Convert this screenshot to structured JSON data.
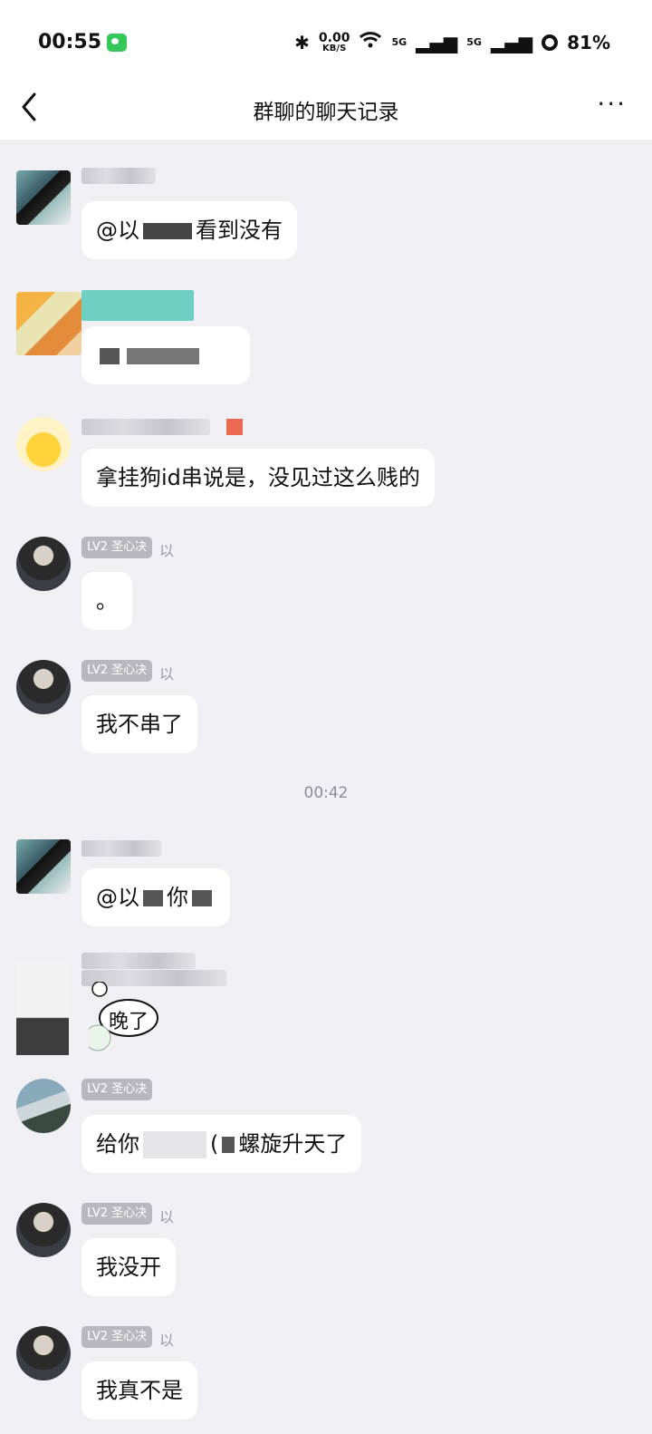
{
  "status_bar": {
    "time": "00:55",
    "speed_value": "0.00",
    "speed_unit": "KB/S",
    "signal1": "5G",
    "signal2": "5G",
    "battery": "81%"
  },
  "header": {
    "title": "群聊的聊天记录",
    "more": "···"
  },
  "messages": [
    {
      "text_before": "@以",
      "text_after": "看到没有"
    },
    {
      "text": ""
    },
    {
      "text": "拿挂狗id串说是，没见过这么贱的"
    },
    {
      "badge": "LV2 圣心决",
      "nick": "以",
      "text": "。"
    },
    {
      "badge": "LV2 圣心决",
      "nick": "以",
      "text": "我不串了"
    },
    {
      "text_before": "@以",
      "text_mid": "你"
    },
    {
      "sticker_text": "晚了"
    },
    {
      "badge": "LV2 圣心决",
      "text_before": "给你",
      "text_mid": "(",
      "text_after": "螺旋升天了"
    },
    {
      "badge": "LV2 圣心决",
      "nick": "以",
      "text": "我没开"
    },
    {
      "badge": "LV2 圣心决",
      "nick": "以",
      "text": "我真不是"
    }
  ],
  "time_divider": "00:42",
  "colors": {
    "accent_badge": "#b7b7bd",
    "background": "#efeff4",
    "bubble": "#ffffff"
  }
}
